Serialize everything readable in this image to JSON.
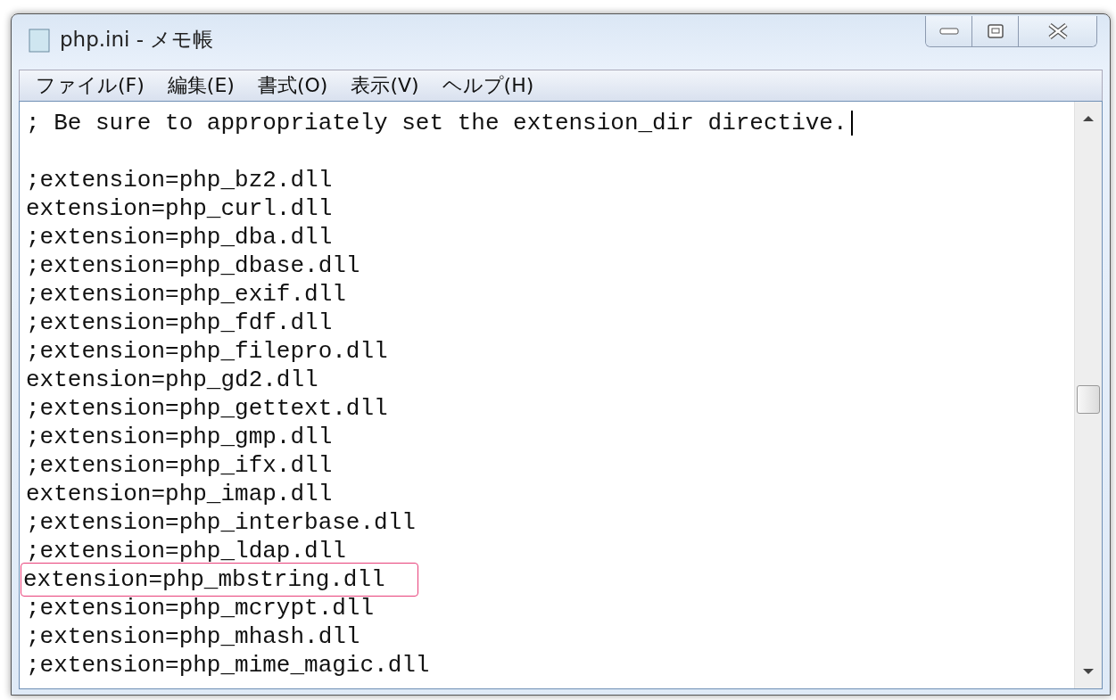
{
  "window": {
    "title": "php.ini - メモ帳"
  },
  "menu": [
    {
      "label": "ファイル(F)"
    },
    {
      "label": "編集(E)"
    },
    {
      "label": "書式(O)"
    },
    {
      "label": "表示(V)"
    },
    {
      "label": "ヘルプ(H)"
    }
  ],
  "editor": {
    "lines": [
      {
        "kind": "text",
        "text": "; Be sure to appropriately set the extension_dir directive.",
        "caret": true,
        "highlighted": false
      },
      {
        "kind": "blank",
        "caret": false
      },
      {
        "kind": "text",
        "text": ";extension=php_bz2.dll",
        "caret": false,
        "highlighted": false
      },
      {
        "kind": "text",
        "text": "extension=php_curl.dll",
        "caret": false,
        "highlighted": false
      },
      {
        "kind": "text",
        "text": ";extension=php_dba.dll",
        "caret": false,
        "highlighted": false
      },
      {
        "kind": "text",
        "text": ";extension=php_dbase.dll",
        "caret": false,
        "highlighted": false
      },
      {
        "kind": "text",
        "text": ";extension=php_exif.dll",
        "caret": false,
        "highlighted": false
      },
      {
        "kind": "text",
        "text": ";extension=php_fdf.dll",
        "caret": false,
        "highlighted": false
      },
      {
        "kind": "text",
        "text": ";extension=php_filepro.dll",
        "caret": false,
        "highlighted": false
      },
      {
        "kind": "text",
        "text": "extension=php_gd2.dll",
        "caret": false,
        "highlighted": false
      },
      {
        "kind": "text",
        "text": ";extension=php_gettext.dll",
        "caret": false,
        "highlighted": false
      },
      {
        "kind": "text",
        "text": ";extension=php_gmp.dll",
        "caret": false,
        "highlighted": false
      },
      {
        "kind": "text",
        "text": ";extension=php_ifx.dll",
        "caret": false,
        "highlighted": false
      },
      {
        "kind": "text",
        "text": "extension=php_imap.dll",
        "caret": false,
        "highlighted": false
      },
      {
        "kind": "text",
        "text": ";extension=php_interbase.dll",
        "caret": false,
        "highlighted": false
      },
      {
        "kind": "text",
        "text": ";extension=php_ldap.dll",
        "caret": false,
        "highlighted": false
      },
      {
        "kind": "text",
        "text": "extension=php_mbstring.dll",
        "caret": false,
        "highlighted": true
      },
      {
        "kind": "text",
        "text": ";extension=php_mcrypt.dll",
        "caret": false,
        "highlighted": false
      },
      {
        "kind": "text",
        "text": ";extension=php_mhash.dll",
        "caret": false,
        "highlighted": false
      },
      {
        "kind": "text",
        "text": ";extension=php_mime_magic.dll",
        "caret": false,
        "highlighted": false
      }
    ]
  }
}
